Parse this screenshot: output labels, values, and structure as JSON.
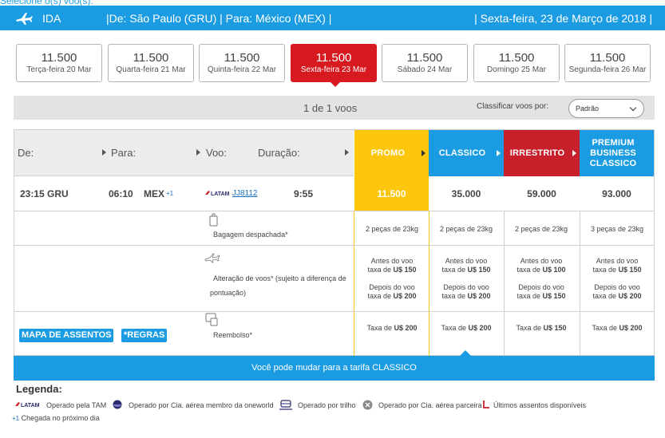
{
  "top_text": "Selecione o(s) voo(s):",
  "header": {
    "direction": "IDA",
    "route": "|De: São Paulo (GRU) | Para: México (MEX) |",
    "date": "| Sexta-feira, 23 de Março de 2018 |"
  },
  "dates": [
    {
      "price": "11.500",
      "day": "Terça-feira 20 Mar",
      "selected": false
    },
    {
      "price": "11.500",
      "day": "Quarta-feira 21 Mar",
      "selected": false
    },
    {
      "price": "11.500",
      "day": "Quinta-feira 22 Mar",
      "selected": false
    },
    {
      "price": "11.500",
      "day": "Sexta-feira 23 Mar",
      "selected": true
    },
    {
      "price": "11.500",
      "day": "Sábado 24 Mar",
      "selected": false
    },
    {
      "price": "11.500",
      "day": "Domingo 25 Mar",
      "selected": false
    },
    {
      "price": "11.500",
      "day": "Segunda-feira 26 Mar",
      "selected": false
    }
  ],
  "filter": {
    "count": "1 de 1 voos",
    "sort_label": "Classificar voos por:",
    "sort_value": "Padrão"
  },
  "table": {
    "headers": {
      "from": "De:",
      "to": "Para:",
      "flight": "Voo:",
      "duration": "Duração:"
    },
    "fares": [
      {
        "line1": "PROMO",
        "line2": "",
        "line3": "",
        "color": "#fcc60c"
      },
      {
        "line1": "CLASSICO",
        "line2": "",
        "line3": "",
        "color": "#1b9ce2"
      },
      {
        "line1": "IRRESTRITO",
        "line2": "",
        "line3": "",
        "color": "#c8202b"
      },
      {
        "line1": "PREMIUM",
        "line2": "BUSINESS",
        "line3": "CLASSICO",
        "color": "#1b9ce2"
      }
    ],
    "flight": {
      "departure": "23:15 GRU",
      "arrival_time": "06:10",
      "arrival_city": "MEX",
      "plus_day": "+1",
      "airline": "LATAM",
      "number": "JJ8112",
      "duration": "9:55",
      "prices": [
        "11.500",
        "35.000",
        "59.000",
        "93.000"
      ]
    },
    "baggage": {
      "label": "Bagagem despachada*",
      "values": [
        "2 peças de 23kg",
        "2 peças de 23kg",
        "2 peças de 23kg",
        "3 peças de 23kg"
      ]
    },
    "change": {
      "label1": "Alteração de voos* (sujeito a diferença de",
      "label2": "pontuação)",
      "before_label": "Antes do voo",
      "after_label": "Depois do voo",
      "fee_prefix": "taxa de ",
      "before_fees": [
        "U$ 150",
        "U$ 150",
        "U$ 100",
        "U$ 150"
      ],
      "after_fees": [
        "U$ 200",
        "U$ 200",
        "U$ 150",
        "U$ 200"
      ]
    },
    "refund": {
      "label": "Reembolso*",
      "fee_prefix": "Taxa de ",
      "fees": [
        "U$ 200",
        "U$ 200",
        "U$ 150",
        "U$ 200"
      ]
    },
    "buttons": {
      "seat_map": "MAPA DE ASSENTOS",
      "rules": "*REGRAS"
    }
  },
  "banner": "Você pode mudar para a tarifa CLASSICO",
  "legend": {
    "title": "Legenda:",
    "latam_logo_text": "LATAM",
    "items": [
      {
        "text": "Operado pela TAM",
        "icon": "latam-logo-icon"
      },
      {
        "text": "Operado por Cia. aérea membro da oneworld",
        "icon": "oneworld-icon"
      },
      {
        "text": "Operado por trilho",
        "icon": "train-icon"
      },
      {
        "text": "Operado por Cia. aérea parceira",
        "icon": "partner-airline-icon"
      },
      {
        "text": "Últimos assentos disponíveis",
        "icon": "last-seats-icon"
      }
    ],
    "next_day_symbol": "+1",
    "next_day_text": "Chegada no próximo dia"
  }
}
